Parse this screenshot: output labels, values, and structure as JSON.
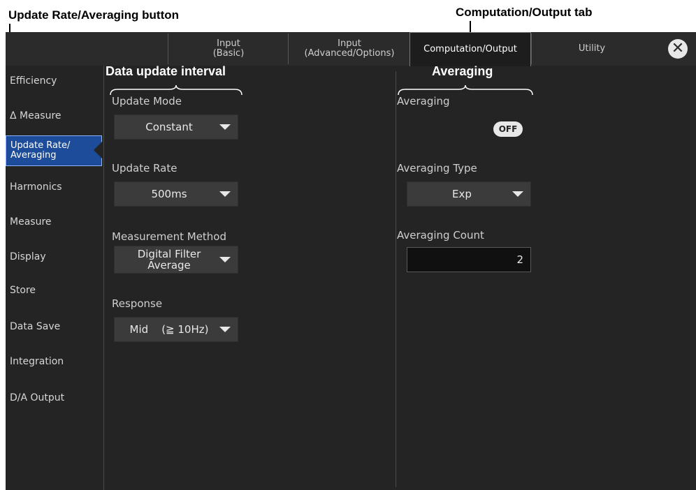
{
  "callouts": {
    "left": "Update Rate/Averaging button",
    "right": "Computation/Output tab"
  },
  "tabs": [
    {
      "label": "Input\n(Basic)"
    },
    {
      "label": "Input\n(Advanced/Options)"
    },
    {
      "label": "Computation/Output"
    },
    {
      "label": "Utility"
    }
  ],
  "close_symbol": "✕",
  "sidebar": {
    "items": [
      {
        "label": "Efficiency"
      },
      {
        "label": "Δ Measure"
      },
      {
        "label": "Update Rate/\nAveraging"
      },
      {
        "label": "Harmonics"
      },
      {
        "label": "Measure"
      },
      {
        "label": "Display"
      },
      {
        "label": "Store"
      },
      {
        "label": "Data Save"
      },
      {
        "label": "Integration"
      },
      {
        "label": "D/A Output"
      }
    ]
  },
  "left_section": {
    "title": "Data update interval",
    "update_mode_label": "Update Mode",
    "update_mode_value": "Constant",
    "update_rate_label": "Update Rate",
    "update_rate_value": "500ms",
    "method_label": "Measurement Method",
    "method_value": "Digital Filter\nAverage",
    "response_label": "Response",
    "response_value": "Mid    (≧ 10Hz)"
  },
  "right_section": {
    "title": "Averaging",
    "averaging_label": "Averaging",
    "averaging_state": "OFF",
    "type_label": "Averaging Type",
    "type_value": "Exp",
    "count_label": "Averaging Count",
    "count_value": "2"
  }
}
